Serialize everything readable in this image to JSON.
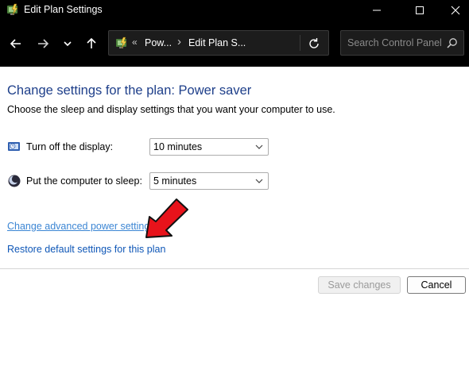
{
  "window": {
    "title": "Edit Plan Settings",
    "icon": "power-options-icon"
  },
  "nav": {
    "back": "arrow-left-icon",
    "forward": "arrow-right-icon",
    "recent": "chevron-down-icon",
    "up": "arrow-up-icon"
  },
  "address": {
    "overflow": "«",
    "segments": [
      "Pow...",
      "Edit Plan S..."
    ],
    "separator": "›",
    "refresh": "refresh-icon"
  },
  "search": {
    "placeholder": "Search Control Panel",
    "icon": "search-icon"
  },
  "page": {
    "title": "Change settings for the plan: Power saver",
    "subtitle": "Choose the sleep and display settings that you want your computer to use."
  },
  "settings": [
    {
      "label": "Turn off the display:",
      "value": "10 minutes",
      "icon": "display-icon"
    },
    {
      "label": "Put the computer to sleep:",
      "value": "5 minutes",
      "icon": "sleep-moon-icon"
    }
  ],
  "links": {
    "advanced": "Change advanced power settings",
    "restore": "Restore default settings for this plan"
  },
  "buttons": {
    "save": "Save changes",
    "cancel": "Cancel"
  },
  "colors": {
    "title_blue": "#1e3f8a",
    "link_blue": "#0f57b7",
    "annotation_red": "#e8131b"
  }
}
